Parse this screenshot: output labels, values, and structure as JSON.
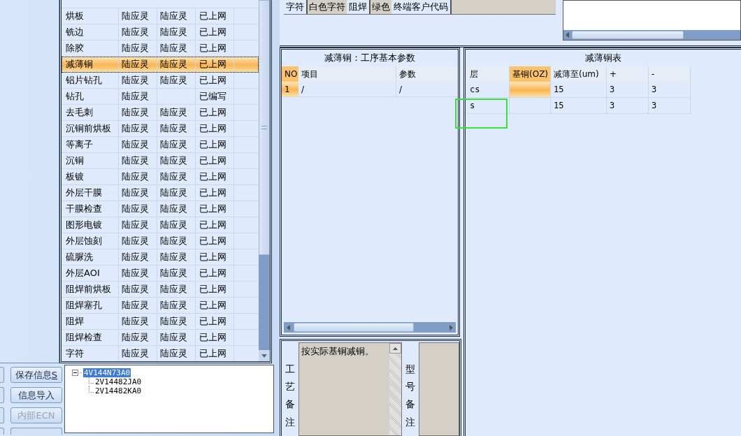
{
  "process_table": {
    "rows": [
      {
        "step": "烘板",
        "person_1": "陆应灵",
        "person_2": "陆应灵",
        "status": "已上网",
        "selected": false
      },
      {
        "step": "铣边",
        "person_1": "陆应灵",
        "person_2": "陆应灵",
        "status": "已上网",
        "selected": false
      },
      {
        "step": "除胶",
        "person_1": "陆应灵",
        "person_2": "陆应灵",
        "status": "已上网",
        "selected": false
      },
      {
        "step": "减薄铜",
        "person_1": "陆应灵",
        "person_2": "陆应灵",
        "status": "已上网",
        "selected": true
      },
      {
        "step": "铝片钻孔",
        "person_1": "陆应灵",
        "person_2": "陆应灵",
        "status": "已上网",
        "selected": false
      },
      {
        "step": "钻孔",
        "person_1": "陆应灵",
        "status": "已编写",
        "selected": false
      },
      {
        "step": "去毛刺",
        "person_1": "陆应灵",
        "person_2": "陆应灵",
        "status": "已上网",
        "selected": false
      },
      {
        "step": "沉铜前烘板",
        "person_1": "陆应灵",
        "person_2": "陆应灵",
        "status": "已上网",
        "selected": false
      },
      {
        "step": "等离子",
        "person_1": "陆应灵",
        "person_2": "陆应灵",
        "status": "已上网",
        "selected": false
      },
      {
        "step": "沉铜",
        "person_1": "陆应灵",
        "person_2": "陆应灵",
        "status": "已上网",
        "selected": false
      },
      {
        "step": "板镀",
        "person_1": "陆应灵",
        "person_2": "陆应灵",
        "status": "已上网",
        "selected": false
      },
      {
        "step": "外层干膜",
        "person_1": "陆应灵",
        "person_2": "陆应灵",
        "status": "已上网",
        "selected": false
      },
      {
        "step": "干膜检查",
        "person_1": "陆应灵",
        "person_2": "陆应灵",
        "status": "已上网",
        "selected": false
      },
      {
        "step": "图形电镀",
        "person_1": "陆应灵",
        "person_2": "陆应灵",
        "status": "已上网",
        "selected": false
      },
      {
        "step": "外层蚀刻",
        "person_1": "陆应灵",
        "person_2": "陆应灵",
        "status": "已上网",
        "selected": false
      },
      {
        "step": "硫脲洗",
        "person_1": "陆应灵",
        "person_2": "陆应灵",
        "status": "已上网",
        "selected": false
      },
      {
        "step": "外层AOI",
        "person_1": "陆应灵",
        "person_2": "陆应灵",
        "status": "已上网",
        "selected": false
      },
      {
        "step": "阻焊前烘板",
        "person_1": "陆应灵",
        "person_2": "陆应灵",
        "status": "已上网",
        "selected": false
      },
      {
        "step": "阻焊塞孔",
        "person_1": "陆应灵",
        "person_2": "陆应灵",
        "status": "已上网",
        "selected": false
      },
      {
        "step": "阻焊",
        "person_1": "陆应灵",
        "person_2": "陆应灵",
        "status": "已上网",
        "selected": false
      },
      {
        "step": "阻焊检查",
        "person_1": "陆应灵",
        "person_2": "陆应灵",
        "status": "已上网",
        "selected": false
      },
      {
        "step": "字符",
        "person_1": "陆应灵",
        "person_2": "陆应灵",
        "status": "已上网",
        "selected": false
      }
    ]
  },
  "buttons": [
    {
      "label": "保存信息",
      "shortcut": "S",
      "disabled": false
    },
    {
      "label": "信息导入",
      "disabled": false
    },
    {
      "label": "内部ECN",
      "disabled": true
    }
  ],
  "tree": {
    "label": "4V144N73A0",
    "selected": true,
    "expanded": true,
    "children": [
      {
        "label": "2V14482JA0",
        "selected": false
      },
      {
        "label": "2V14482KA0",
        "selected": false
      }
    ]
  },
  "fields": [
    {
      "label": "字符",
      "value": "白色字符"
    },
    {
      "label": "阻焊",
      "value": "绿色"
    },
    {
      "label": "终端客户代码"
    }
  ],
  "params_panel": {
    "title": "减薄铜：工序基本参数",
    "columns": [
      "NO",
      "项目",
      "参数"
    ],
    "rows": [
      {
        "no": "1",
        "item": "/",
        "value": "/",
        "selected": true
      }
    ]
  },
  "remarks": [
    {
      "label": "工艺备注",
      "text": "按实际基铜减铜。"
    },
    {
      "label": "型号备注"
    }
  ],
  "thin_table": {
    "title": "减薄铜表",
    "columns": [
      {
        "label": "层",
        "selected": false
      },
      {
        "label": "基铜(OZ)",
        "selected": true
      },
      {
        "label": "减薄至(um)",
        "selected": false
      },
      {
        "label": "+",
        "selected": false
      },
      {
        "label": "-",
        "selected": false
      }
    ],
    "rows": [
      {
        "layer": "cs",
        "thin_to": "15",
        "plus": "3",
        "minus": "3",
        "selected": true
      },
      {
        "layer": "s",
        "thin_to": "15",
        "plus": "3",
        "minus": "3",
        "selected": false
      }
    ]
  }
}
